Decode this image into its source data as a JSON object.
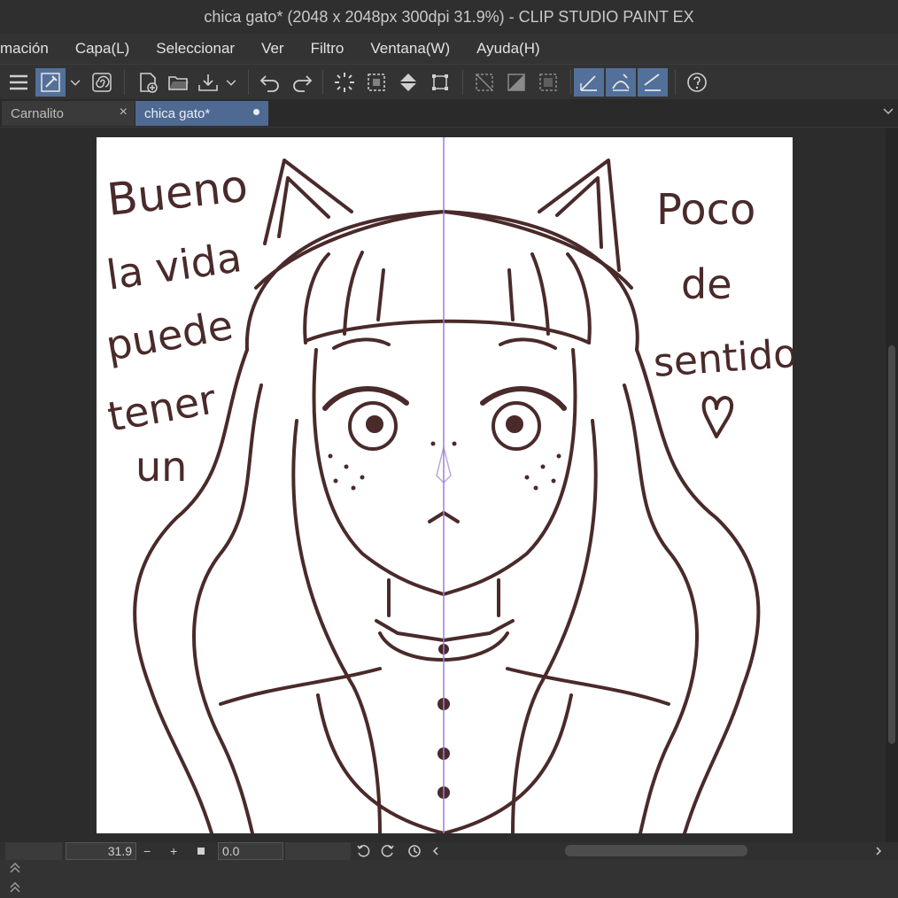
{
  "window": {
    "title": "chica gato* (2048 x 2048px 300dpi 31.9%)  - CLIP STUDIO PAINT EX"
  },
  "menu": [
    "mación",
    "Capa(L)",
    "Seleccionar",
    "Ver",
    "Filtro",
    "Ventana(W)",
    "Ayuda(H)"
  ],
  "tabs": [
    {
      "label": "Carnalito",
      "close": "×"
    },
    {
      "label": "chica gato*"
    }
  ],
  "canvas": {
    "text_left": [
      "Bueno",
      "la vida",
      "puede",
      "tener",
      "un"
    ],
    "text_right": [
      "Poco",
      "de",
      "sentido"
    ],
    "ink_color": "#4a2a2a"
  },
  "status": {
    "zoom": "31.9",
    "minus": "−",
    "plus": "+",
    "angle": "0.0"
  },
  "colors": {
    "accent": "#52709a",
    "background": "#2b2b2b",
    "guide": "#9b7fd4"
  }
}
